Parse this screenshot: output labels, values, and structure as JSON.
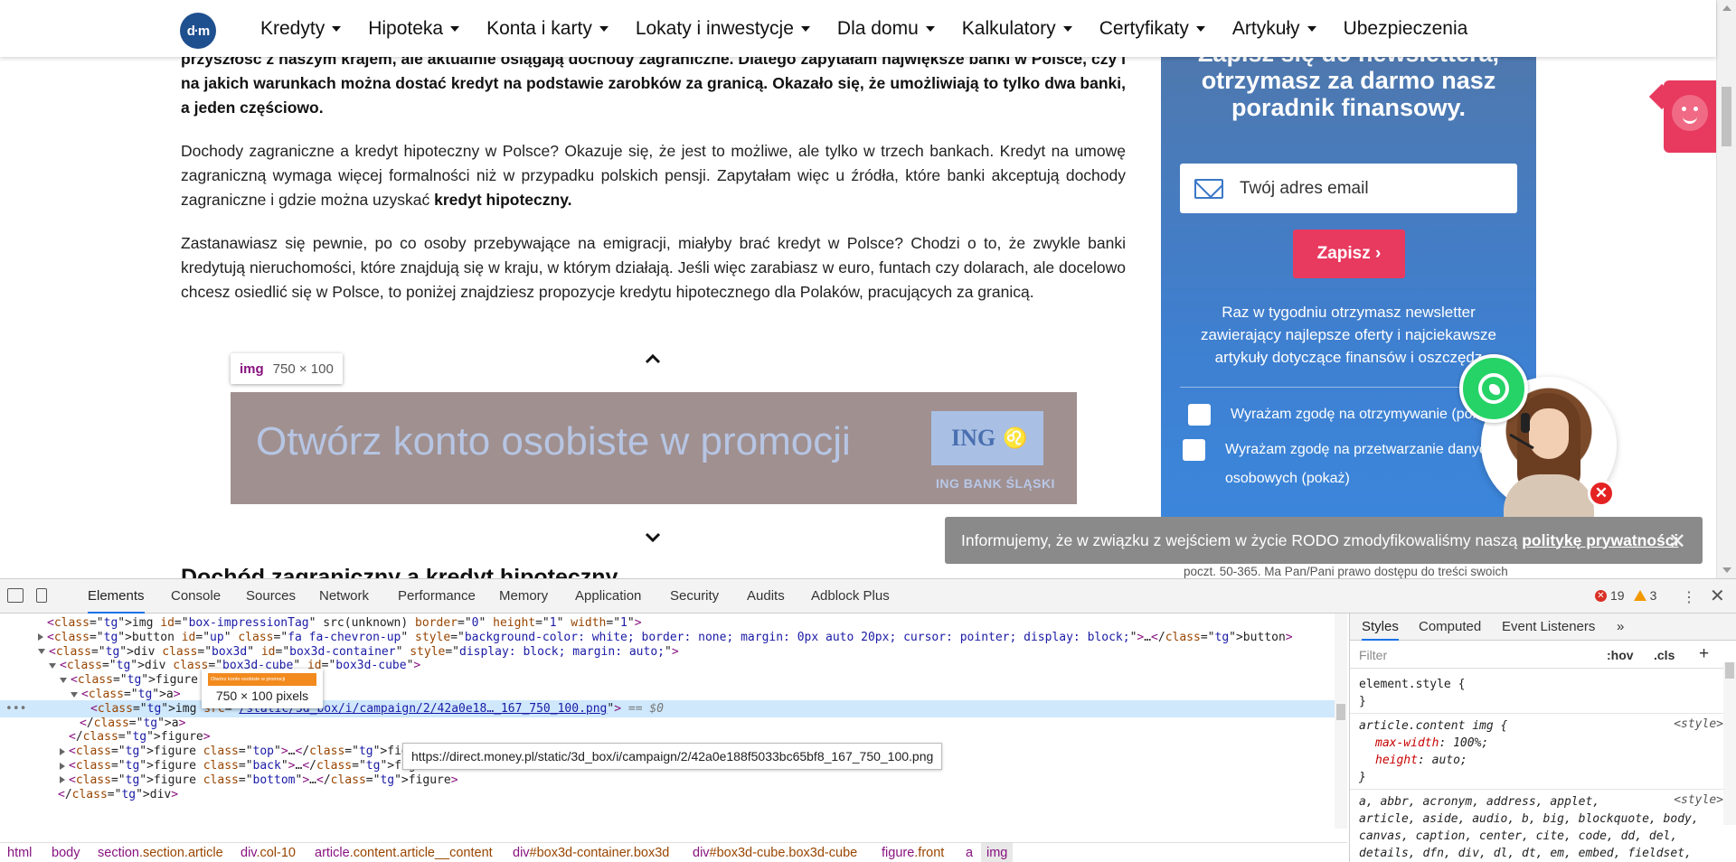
{
  "nav": {
    "logo_text": "d·m",
    "items": [
      "Kredyty",
      "Hipoteka",
      "Konta i karty",
      "Lokaty i inwestycje",
      "Dla domu",
      "Kalkulatory",
      "Certyfikaty",
      "Artykuły",
      "Ubezpieczenia"
    ],
    "dropdown_flags": [
      true,
      true,
      true,
      true,
      true,
      true,
      true,
      true,
      false
    ]
  },
  "article": {
    "p1": "przyszłość z naszym krajem, ale aktualnie osiągają dochody zagraniczne. Dlatego zapytałam największe banki w Polsce, czy i na jakich warunkach można dostać kredyt na podstawie zarobków za granicą. Okazało się, że umożliwiają to tylko dwa banki, a jeden częściowo.",
    "p2_start": "Dochody zagraniczne a kredyt hipoteczny w Polsce? Okazuje się, że jest to możliwe, ale tylko w trzech bankach. Kredyt na umowę zagraniczną wymaga więcej formalności niż w przypadku polskich pensji. Zapytałam więc u źródła, które banki akceptują dochody zagraniczne i gdzie można uzyskać ",
    "p2_bold": "kredyt hipoteczny.",
    "p3": "Zastanawiasz się pewnie, po co osoby przebywające na emigracji, miałyby brać kredyt w Polsce? Chodzi o to, że zwykle banki kredytują nieruchomości, które znajdują się w kraju, w którym działają. Jeśli więc zarabiasz w euro, funtach czy dolarach, ale docelowo chcesz osiedlić się w Polsce, to poniżej znajdziesz propozycje kredytu hipotecznego dla Polaków, pracujących za granicą.",
    "img_tip_tag": "img",
    "img_tip_dim": "750 × 100",
    "banner_text": "Otwórz konto osobiste w promocji",
    "banner_brand": "ING",
    "banner_brand_sub": "ING BANK ŚLĄSKI",
    "next_heading": "Dochód zagraniczny a kredyt hipoteczny"
  },
  "newsletter": {
    "title": "Zapisz się do newslettera, otrzymasz za darmo nasz poradnik finansowy.",
    "email_placeholder": "Twój adres email",
    "button": "Zapisz ›",
    "text": "Raz w tygodniu otrzymasz newsletter zawierający najlepsze oferty i najciekawsze artykuły dotyczące finansów i oszczędz",
    "consent1": "Wyrażam zgodę na otrzymywanie (poka",
    "consent2_l1": "Wyrażam zgodę na przetwarzanie danyc",
    "consent2_l2": "osobowych (pokaż)"
  },
  "rodo": {
    "text": "Informujemy, że w związku z wejściem w życie RODO zmodyfikowaliśmy naszą",
    "link": "politykę prywatności",
    "close": "✕"
  },
  "footer_snippet": "poczt. 50-365. Ma Pan/Pani prawo dostępu do treści swoich",
  "devtools": {
    "tabs": [
      "Elements",
      "Console",
      "Sources",
      "Network",
      "Performance",
      "Memory",
      "Application",
      "Security",
      "Audits",
      "Adblock Plus"
    ],
    "errors": "19",
    "warnings": "3",
    "menu": "⋮",
    "close": "✕",
    "dom_lines": [
      {
        "indent": 5,
        "tri": "",
        "html": "<img id=\"box-impressionTag\" src(unknown) border=\"0\" height=\"1\" width=\"1\">"
      },
      {
        "indent": 5,
        "tri": "r",
        "html": "<button id=\"up\" class=\"fa fa-chevron-up\" style=\"background-color: white; border: none; margin: 0px auto 20px; cursor: pointer; display: block;\">…</button>"
      },
      {
        "indent": 5,
        "tri": "d",
        "html": "<div class=\"box3d\" id=\"box3d-container\" style=\"display: block; margin: auto;\">"
      },
      {
        "indent": 6,
        "tri": "d",
        "html": "<div class=\"box3d-cube\" id=\"box3d-cube\">"
      },
      {
        "indent": 7,
        "tri": "d",
        "html": "<figure class=\"front\">"
      },
      {
        "indent": 8,
        "tri": "d",
        "html": "<a>"
      },
      {
        "indent": 9,
        "tri": "",
        "html": "<img src=\"/static/3d_box/i/campaign/2/42a0e18…_167_750_100.png\"> == $0",
        "selected": true
      },
      {
        "indent": 8,
        "tri": "",
        "html": "</a>"
      },
      {
        "indent": 7,
        "tri": "",
        "html": "</figure>"
      },
      {
        "indent": 7,
        "tri": "r",
        "html": "<figure class=\"top\">…</figure>"
      },
      {
        "indent": 7,
        "tri": "r",
        "html": "<figure class=\"back\">…</figure>"
      },
      {
        "indent": 7,
        "tri": "r",
        "html": "<figure class=\"bottom\">…</figure>"
      },
      {
        "indent": 6,
        "tri": "",
        "html": "</div>"
      }
    ],
    "px_tip": "750 × 100 pixels",
    "px_tip_thumb": "Otwórz konto osobiste w promocji",
    "url_tip": "https://direct.money.pl/static/3d_box/i/campaign/2/42a0e188f5033bc65bf8_167_750_100.png",
    "breadcrumbs": [
      "html",
      "body",
      "section.section.article",
      "div.col-10",
      "article.content.article__content",
      "div#box3d-container.box3d",
      "div#box3d-cube.box3d-cube",
      "figure.front",
      "a",
      "img"
    ],
    "styles_tabs": [
      "Styles",
      "Computed",
      "Event Listeners",
      "»"
    ],
    "filter_placeholder": "Filter",
    "hov": ":hov",
    "cls": ".cls",
    "rules": {
      "element_style": "element.style {",
      "close1": "}",
      "selector2": "article.content img {",
      "source2": "<style>",
      "prop_a": "max-width",
      "val_a": "100%;",
      "prop_b": "height",
      "val_b": "auto;",
      "close2": "}",
      "selector3_l1": "a, abbr, acronym, address, applet,",
      "source3": "<style>",
      "selector3_l2": "article, aside, audio, b, big, blockquote, body,",
      "selector3_l3": "canvas, caption, center, cite, code, dd, del,",
      "selector3_l4": "details, dfn, div, dl, dt, em, embed, fieldset,"
    }
  }
}
